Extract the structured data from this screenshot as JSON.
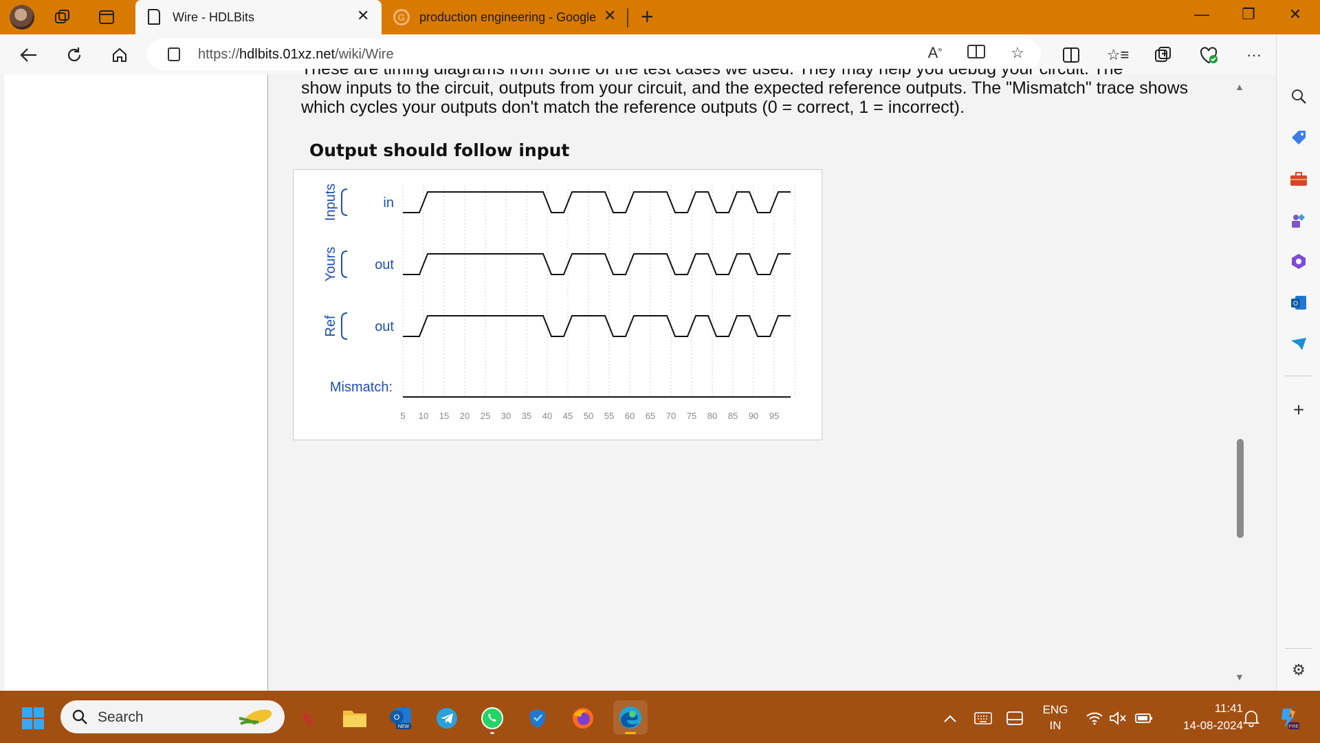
{
  "browser": {
    "tabs": [
      {
        "title": "Wire - HDLBits",
        "active": true
      },
      {
        "title": "production engineering - Google",
        "active": false
      }
    ],
    "url_prefix": "https://",
    "url_host": "hdlbits.01xz.net",
    "url_path": "/wiki/Wire",
    "accent_color": "#d97a00"
  },
  "content": {
    "intro_cut": "These are timing diagrams from some of the test cases we used. They may help you debug your circuit. The diagrams",
    "intro_line2": "show inputs to the circuit, outputs from your circuit, and the expected reference outputs. The \"Mismatch\" trace shows",
    "intro_line3": "which cycles your outputs don't match the reference outputs (0 = correct, 1 = incorrect).",
    "section_title": "Output should follow input",
    "diagram": {
      "groups": [
        {
          "label": "Inputs",
          "signal": "in"
        },
        {
          "label": "Yours",
          "signal": "out"
        },
        {
          "label": "Ref",
          "signal": "out"
        }
      ],
      "mismatch_label": "Mismatch:",
      "ticks": [
        "5",
        "10",
        "15",
        "20",
        "25",
        "30",
        "35",
        "40",
        "45",
        "50",
        "55",
        "60",
        "65",
        "70",
        "75",
        "80",
        "85",
        "90",
        "95"
      ],
      "waveform_levels": [
        0,
        1,
        1,
        1,
        1,
        1,
        1,
        0,
        1,
        1,
        0,
        1,
        1,
        0,
        1,
        0,
        1,
        0,
        1
      ],
      "mismatch_levels": [
        0,
        0,
        0,
        0,
        0,
        0,
        0,
        0,
        0,
        0,
        0,
        0,
        0,
        0,
        0,
        0,
        0,
        0,
        0
      ],
      "label_color": "#1e4fb3"
    }
  },
  "taskbar": {
    "search_label": "Search",
    "language": "ENG",
    "region": "IN",
    "time": "11:41",
    "date": "14-08-2024"
  }
}
